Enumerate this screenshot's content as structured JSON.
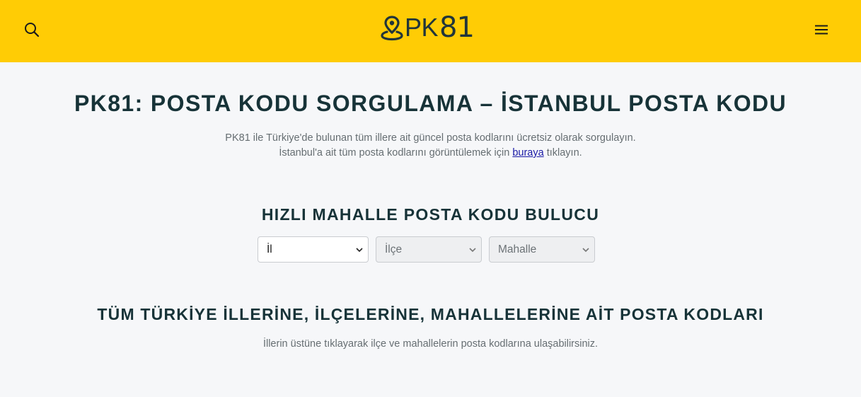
{
  "header": {
    "logo_text": "PK",
    "logo_number": "81",
    "search_icon": "search-icon",
    "menu_icon": "hamburger-menu-icon",
    "brand_color": "#ffcc05"
  },
  "main": {
    "title": "PK81: POSTA KODU SORGULAMA – İSTANBUL POSTA KODU",
    "intro_line1": "PK81 ile Türkiye'de bulunan tüm illere ait güncel posta kodlarını ücretsiz olarak sorgulayın.",
    "intro_line2_before": "İstanbul'a ait tüm posta kodlarını görüntülemek için",
    "intro_link": "buraya",
    "intro_line2_after": "tıklayın."
  },
  "finder": {
    "title": "HIZLI MAHALLE POSTA KODU BULUCU",
    "il_label": "İl",
    "ilce_label": "İlçe",
    "mahalle_label": "Mahalle"
  },
  "all_codes": {
    "title": "TÜM TÜRKİYE İLLERİNE, İLÇELERİNE, MAHALLELERİNE AİT POSTA KODLARI",
    "description": "İllerin üstüne tıklayarak ilçe ve mahallelerin posta kodlarına ulaşabilirsiniz."
  }
}
